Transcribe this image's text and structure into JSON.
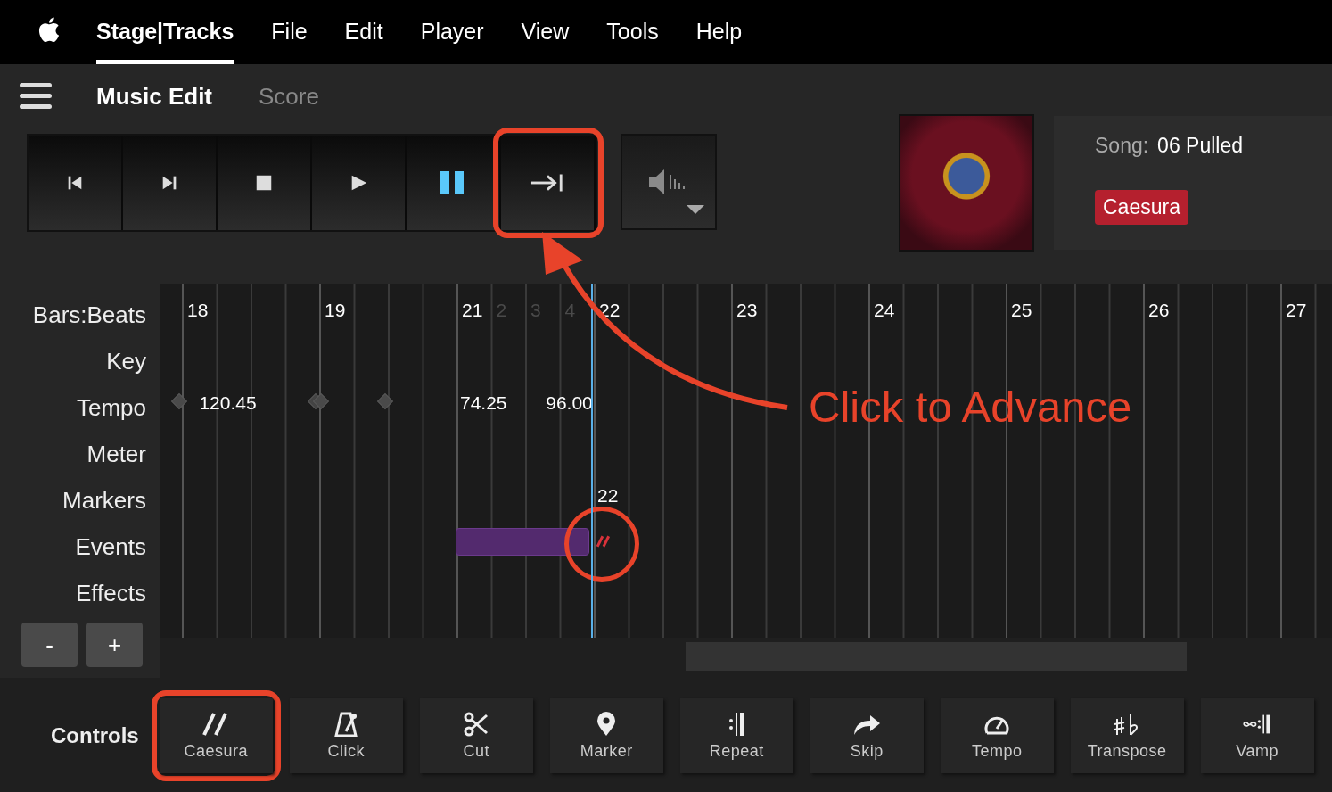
{
  "menu": [
    {
      "label": "Stage|Tracks",
      "selected": true
    },
    {
      "label": "File",
      "selected": false
    },
    {
      "label": "Edit",
      "selected": false
    },
    {
      "label": "Player",
      "selected": false
    },
    {
      "label": "View",
      "selected": false
    },
    {
      "label": "Tools",
      "selected": false
    },
    {
      "label": "Help",
      "selected": false
    }
  ],
  "tabs": [
    {
      "label": "Music Edit",
      "selected": true
    },
    {
      "label": "Score",
      "selected": false
    }
  ],
  "transport": [
    {
      "kind": "previous",
      "active": false,
      "highlighted": false
    },
    {
      "kind": "next",
      "active": false,
      "highlighted": false
    },
    {
      "kind": "stop",
      "active": false,
      "highlighted": false
    },
    {
      "kind": "play",
      "active": false,
      "highlighted": false
    },
    {
      "kind": "pause",
      "active": true,
      "highlighted": false
    },
    {
      "kind": "advance",
      "active": false,
      "highlighted": true
    }
  ],
  "song": {
    "label": "Song:",
    "title": "06 Pulled",
    "badge": "Caesura"
  },
  "tracks": [
    "Bars:Beats",
    "Key",
    "Tempo",
    "Meter",
    "Markers",
    "Events",
    "Effects"
  ],
  "zoom_buttons": [
    "-",
    "+"
  ],
  "ruler": [
    {
      "label": "18",
      "dim": false
    },
    {
      "label": "19",
      "dim": false
    },
    {
      "label": "21",
      "dim": false
    },
    {
      "label": "2",
      "dim": true
    },
    {
      "label": "3",
      "dim": true
    },
    {
      "label": "4",
      "dim": true
    },
    {
      "label": "22",
      "dim": false
    },
    {
      "label": "23",
      "dim": false
    },
    {
      "label": "24",
      "dim": false
    },
    {
      "label": "25",
      "dim": false
    },
    {
      "label": "26",
      "dim": false
    },
    {
      "label": "27",
      "dim": false
    }
  ],
  "tempo": [
    {
      "kind": "point"
    },
    {
      "kind": "value",
      "text": "120.45"
    },
    {
      "kind": "double-point"
    },
    {
      "kind": "point"
    },
    {
      "kind": "value",
      "text": "74.25"
    },
    {
      "kind": "value",
      "text": "96.00"
    }
  ],
  "markers": [
    {
      "label": "22"
    }
  ],
  "events": [
    {
      "kind": "region",
      "highlighted": false
    },
    {
      "kind": "caesura",
      "highlighted": true
    }
  ],
  "controls_label": "Controls",
  "controls": [
    {
      "label": "Caesura",
      "kind": "caesura",
      "highlighted": true
    },
    {
      "label": "Click",
      "kind": "click",
      "highlighted": false
    },
    {
      "label": "Cut",
      "kind": "cut",
      "highlighted": false
    },
    {
      "label": "Marker",
      "kind": "marker",
      "highlighted": false
    },
    {
      "label": "Repeat",
      "kind": "repeat",
      "highlighted": false
    },
    {
      "label": "Skip",
      "kind": "skip",
      "highlighted": false
    },
    {
      "label": "Tempo",
      "kind": "tempo",
      "highlighted": false
    },
    {
      "label": "Transpose",
      "kind": "transpose",
      "highlighted": false
    },
    {
      "label": "Vamp",
      "kind": "vamp",
      "highlighted": false
    }
  ],
  "callout": {
    "text": "Click to Advance"
  }
}
